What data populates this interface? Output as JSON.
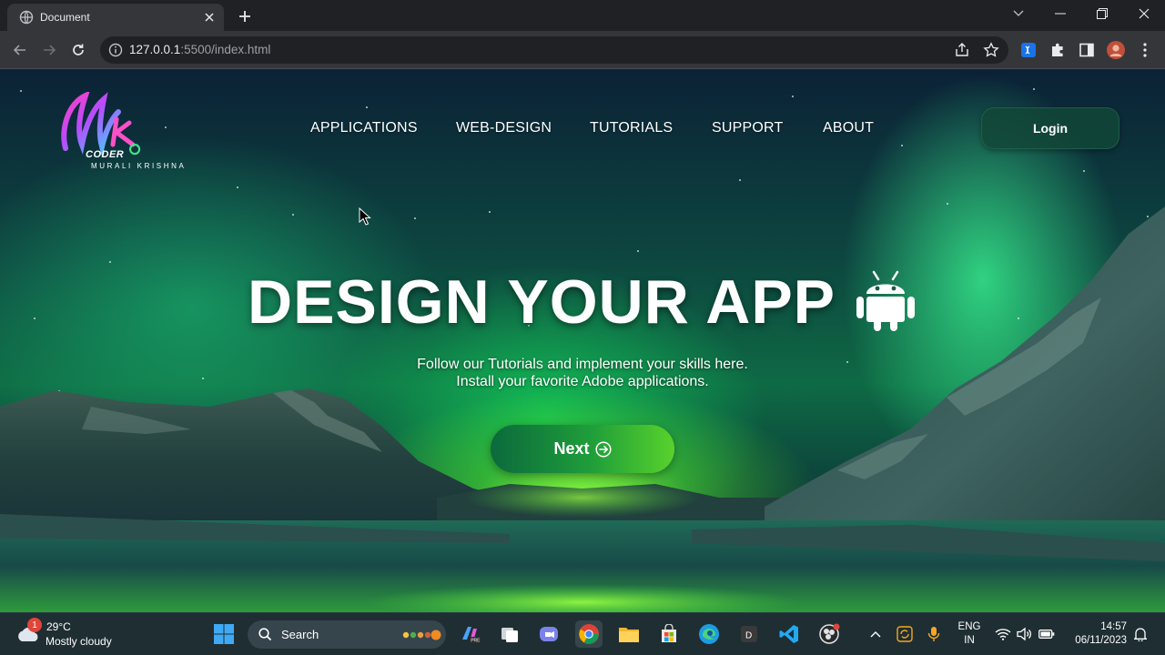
{
  "browser": {
    "tab_title": "Document",
    "url_host": "127.0.0.1",
    "url_rest": ":5500/index.html"
  },
  "logo": {
    "coder": "CODER",
    "name": "MURALI KRISHNA"
  },
  "nav": {
    "items": [
      "APPLICATIONS",
      "WEB-DESIGN",
      "TUTORIALS",
      "SUPPORT",
      "ABOUT"
    ],
    "login": "Login"
  },
  "hero": {
    "title": "DESIGN YOUR APP",
    "line1": "Follow our Tutorials and implement your skills here.",
    "line2": "Install your favorite Adobe applications.",
    "next": "Next"
  },
  "taskbar": {
    "weather_badge": "1",
    "temperature": "29°C",
    "condition": "Mostly cloudy",
    "search_placeholder": "Search",
    "lang_line1": "ENG",
    "lang_line2": "IN",
    "time": "14:57",
    "date": "06/11/2023"
  },
  "colors": {
    "accent_green": "#58d22c",
    "login_bg": "#12463a",
    "chrome_dark": "#202124"
  }
}
